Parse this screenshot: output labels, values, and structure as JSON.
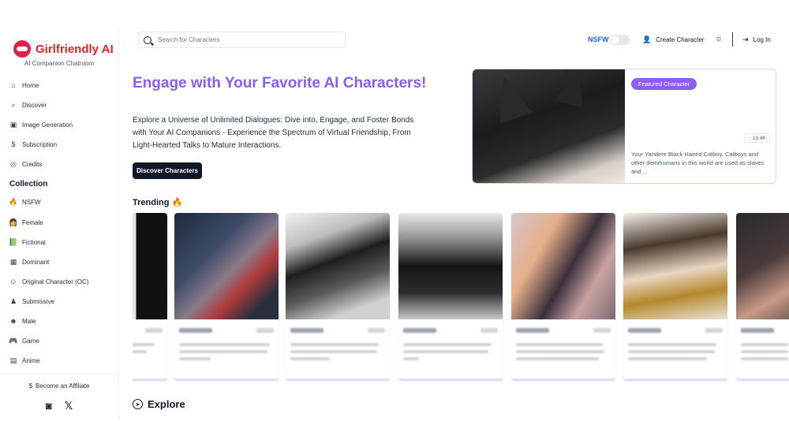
{
  "brand": {
    "name": "Girlfriendly AI",
    "subtitle": "AI Companion Chatroom"
  },
  "sidebar": {
    "nav": [
      {
        "label": "Home",
        "icon": "home-icon"
      },
      {
        "label": "Discover",
        "icon": "search-icon"
      },
      {
        "label": "Image Generation",
        "icon": "image-icon"
      },
      {
        "label": "Subscription",
        "icon": "dollar-icon"
      },
      {
        "label": "Credits",
        "icon": "coins-icon"
      }
    ],
    "collection_title": "Collection",
    "collection": [
      {
        "label": "NSFW",
        "icon": "flame-icon"
      },
      {
        "label": "Female",
        "icon": "female-face-icon"
      },
      {
        "label": "Fictional",
        "icon": "book-icon"
      },
      {
        "label": "Dominant",
        "icon": "dominant-icon"
      },
      {
        "label": "Original Character (OC)",
        "icon": "oc-icon"
      },
      {
        "label": "Submissive",
        "icon": "submissive-icon"
      },
      {
        "label": "Male",
        "icon": "male-face-icon"
      },
      {
        "label": "Game",
        "icon": "gamepad-icon"
      },
      {
        "label": "Anime",
        "icon": "anime-icon"
      }
    ],
    "affiliate": "Become an Affiliate",
    "socials": [
      "discord-icon",
      "x-icon"
    ]
  },
  "topbar": {
    "search_placeholder": "Search for Characters",
    "nsfw_label": "NSFW",
    "create_label": "Create Character",
    "login_label": "Log In"
  },
  "hero": {
    "title": "Engage with Your Favorite AI Characters!",
    "text": "Explore a Universe of Unlimited Dialogues: Dive into, Engage, and Foster Bonds with Your AI Companions - Experience the Spectrum of Virtual Friendship, From Light-Hearted Talks to Mature Interactions.",
    "button": "Discover Characters"
  },
  "featured": {
    "badge": "Featured Character",
    "count": "13.4K",
    "description": "Your Yandere Black Haired Catboy. Catboys and other demihumans in this world are used as slaves and ..."
  },
  "trending": {
    "title": "Trending",
    "flame": "🔥"
  },
  "explore": {
    "title": "Explore"
  },
  "colors": {
    "accent": "#8b5cf6",
    "brand": "#dc2626",
    "nsfw": "#2563eb"
  }
}
